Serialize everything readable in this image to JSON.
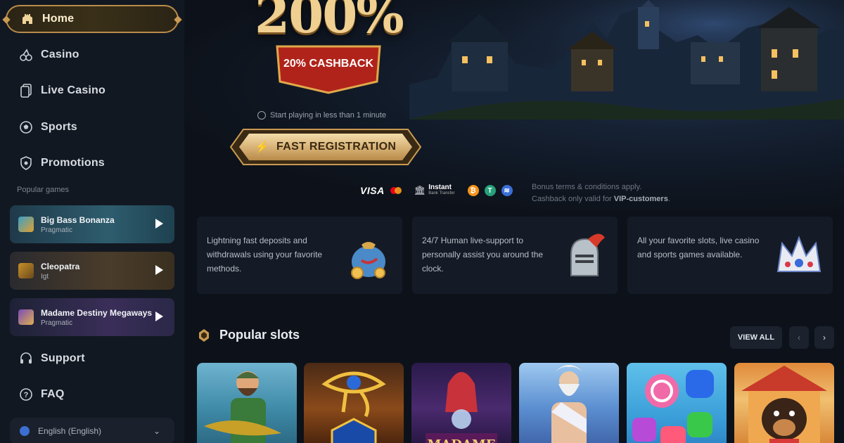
{
  "sidebar": {
    "nav": [
      {
        "label": "Home",
        "icon": "home-icon",
        "active": true
      },
      {
        "label": "Casino",
        "icon": "cherries-icon"
      },
      {
        "label": "Live Casino",
        "icon": "cards-icon"
      },
      {
        "label": "Sports",
        "icon": "soccer-ball-icon"
      },
      {
        "label": "Promotions",
        "icon": "shield-icon"
      }
    ],
    "popular_label": "Popular games",
    "popular_games": [
      {
        "name": "Big Bass Bonanza",
        "provider": "Pragmatic"
      },
      {
        "name": "Cleopatra",
        "provider": "Igt"
      },
      {
        "name": "Madame Destiny Megaways",
        "provider": "Pragmatic"
      }
    ],
    "support_label": "Support",
    "faq_label": "FAQ",
    "language": "English (English)"
  },
  "hero": {
    "percent": "200%",
    "cashback": "20% CASHBACK",
    "start_text": "Start playing in less than 1 minute",
    "register_label": "FAST REGISTRATION",
    "payments": {
      "visa": "VISA",
      "instant_title": "Instant",
      "instant_sub": "Bank Transfer"
    },
    "terms_line1": "Bonus terms & conditions apply.",
    "terms_line2_prefix": "Cashback only valid for ",
    "terms_line2_bold": "VIP-customers",
    "terms_line2_suffix": "."
  },
  "features": [
    {
      "text": "Lightning fast deposits and withdrawals using your favorite methods.",
      "icon": "money-bag-icon"
    },
    {
      "text": "24/7 Human live-support to personally assist you around the clock.",
      "icon": "knight-helmet-icon"
    },
    {
      "text": "All your favorite slots, live casino and sports games available.",
      "icon": "crown-icon"
    }
  ],
  "slots_section": {
    "title": "Popular slots",
    "view_all": "VIEW ALL",
    "prev": "‹",
    "next": "›",
    "tiles": [
      {
        "name": "fisherman-slot"
      },
      {
        "name": "eye-of-horus-slot"
      },
      {
        "name": "madame-destiny-slot",
        "caption": "MADAME"
      },
      {
        "name": "zeus-slot"
      },
      {
        "name": "sweet-candy-slot"
      },
      {
        "name": "dog-house-slot"
      }
    ]
  },
  "colors": {
    "background": "#0d121a",
    "sidebar": "#121821",
    "gold_accent": "#b98b4a",
    "cashback_red": "#b0231a"
  }
}
